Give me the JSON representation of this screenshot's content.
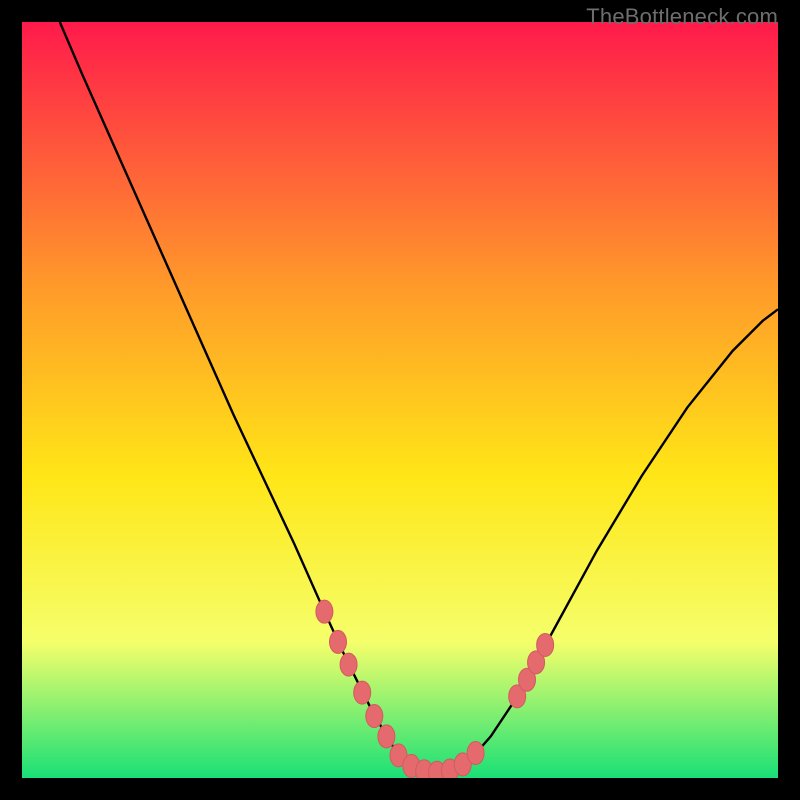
{
  "watermark": "TheBottleneck.com",
  "colors": {
    "gradient_top": "#ff1a4b",
    "gradient_mid1": "#ff9a2a",
    "gradient_mid2": "#ffe617",
    "gradient_mid3": "#f5ff6b",
    "gradient_bottom": "#19e076",
    "curve": "#000000",
    "marker_fill": "#e46a6e",
    "marker_stroke": "#d35a5e"
  },
  "chart_data": {
    "type": "line",
    "title": "",
    "xlabel": "",
    "ylabel": "",
    "xlim": [
      0,
      100
    ],
    "ylim": [
      0,
      100
    ],
    "curve": {
      "x": [
        5,
        8,
        12,
        16,
        20,
        24,
        28,
        32,
        36,
        40,
        43,
        46,
        48.5,
        50.5,
        52.5,
        55,
        58,
        60.5,
        62,
        65,
        70,
        76,
        82,
        88,
        94,
        98,
        100
      ],
      "y": [
        100,
        93,
        84,
        75,
        66,
        57,
        48,
        39.5,
        31,
        22,
        15.5,
        9.5,
        5,
        2.2,
        0.8,
        0.6,
        1.6,
        3.8,
        5.5,
        10,
        19,
        30,
        40,
        49,
        56.5,
        60.5,
        62
      ]
    },
    "series": [
      {
        "name": "markers-left",
        "x": [
          40.0,
          41.8,
          43.2,
          45.0,
          46.6,
          48.2
        ],
        "y": [
          22.0,
          18.0,
          15.0,
          11.3,
          8.2,
          5.5
        ]
      },
      {
        "name": "markers-bottom",
        "x": [
          49.8,
          51.5,
          53.2,
          54.9,
          56.6,
          58.3,
          60.0
        ],
        "y": [
          3.0,
          1.6,
          0.9,
          0.7,
          1.0,
          1.8,
          3.3
        ]
      },
      {
        "name": "markers-right",
        "x": [
          65.5,
          66.8,
          68.0,
          69.2
        ],
        "y": [
          10.8,
          13.0,
          15.3,
          17.6
        ]
      }
    ]
  }
}
